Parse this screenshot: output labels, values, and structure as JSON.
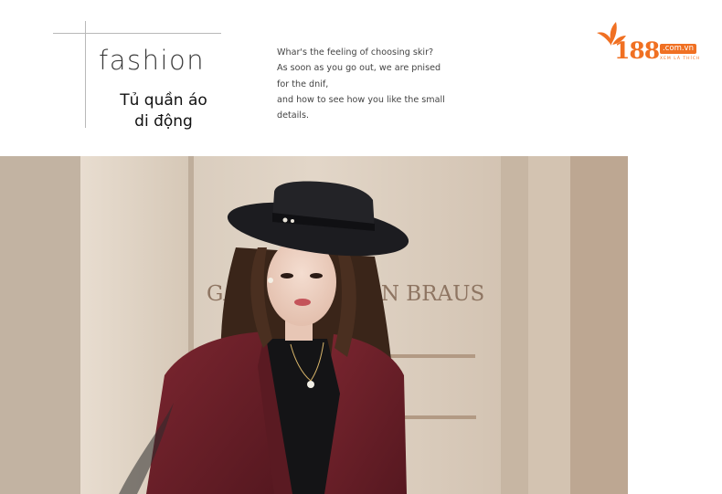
{
  "header": {
    "brand_word": "fashion",
    "subtitle_line1": "Tủ quần áo",
    "subtitle_line2": "di động",
    "description_lines": [
      "Whar's the feeling of choosing skir?",
      "As soon as you go out, we are pnised",
      "for the dnif,",
      "and how to see how you like the small",
      "details."
    ]
  },
  "logo": {
    "number": "188",
    "domain": ".com.vn",
    "slogan": "XEM LÀ THÍCH",
    "color": "#f07022"
  },
  "photo": {
    "sign_text_left": "GA",
    "sign_text_right": "ON BRAUS",
    "colors": {
      "wall": "#d9cbbb",
      "coat": "#6e1f26",
      "hat": "#1c1c20",
      "sweater": "#141416",
      "hair": "#3a2519"
    }
  }
}
